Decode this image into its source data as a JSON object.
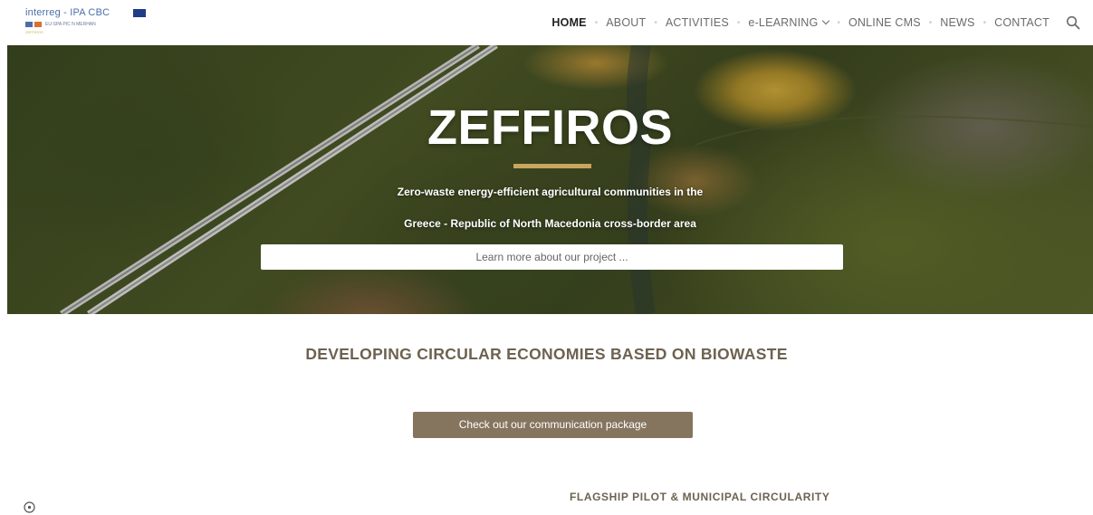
{
  "header": {
    "logo": {
      "title": "interreg - IPA CBC",
      "subtitle": "EU-SPA PIC N MERHAN",
      "tagline": "ZEFFIROS"
    },
    "nav": [
      {
        "label": "HOME",
        "active": true
      },
      {
        "label": "ABOUT",
        "active": false
      },
      {
        "label": "ACTIVITIES",
        "active": false
      },
      {
        "label": "e-LEARNING",
        "active": false,
        "has_dropdown": true
      },
      {
        "label": "ONLINE CMS",
        "active": false
      },
      {
        "label": "NEWS",
        "active": false
      },
      {
        "label": "CONTACT",
        "active": false
      }
    ],
    "search_icon": "search-icon"
  },
  "hero": {
    "title": "ZEFFIROS",
    "subtitle_line1": "Zero-waste energy-efficient agricultural communities in the",
    "subtitle_line2": "Greece - Republic of North Macedonia cross-border area",
    "button_label": "Learn more about our project ...",
    "accent_color": "#c9a560"
  },
  "main": {
    "section_title": "DEVELOPING CIRCULAR ECONOMIES BASED ON BIOWASTE",
    "comm_button_label": "Check out our communication package",
    "comm_button_color": "#85755e",
    "flagship_heading": "FLAGSHIP PILOT & MUNICIPAL CIRCULARITY"
  },
  "footer": {
    "info_icon": "info-icon"
  }
}
